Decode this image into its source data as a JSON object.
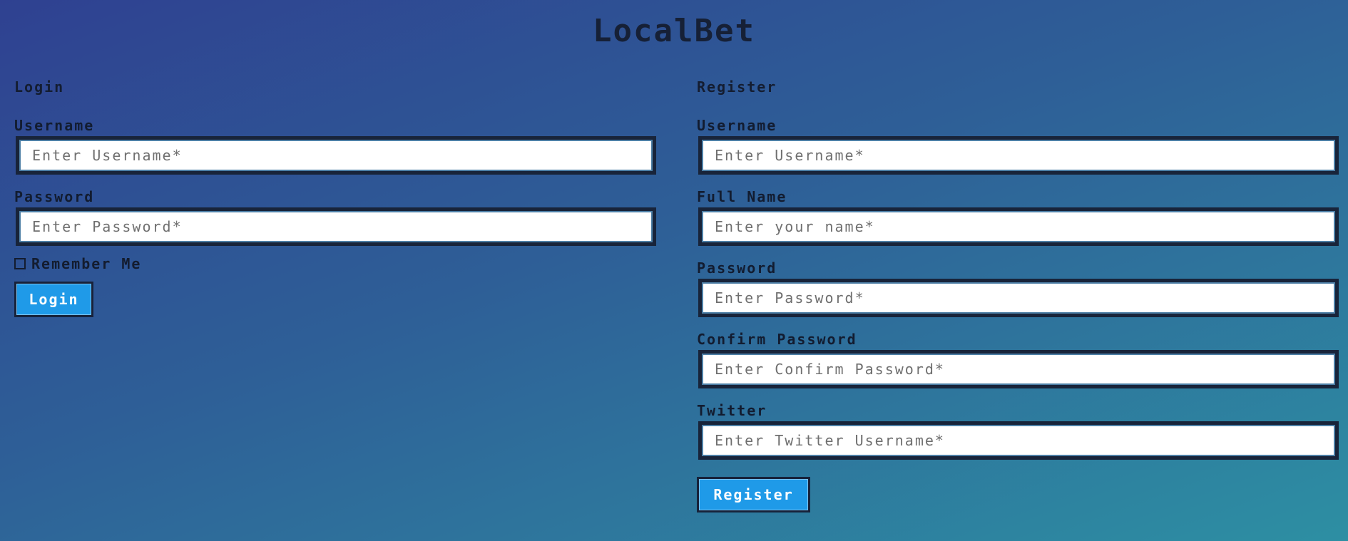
{
  "app": {
    "title": "LocalBet"
  },
  "login": {
    "heading": "Login",
    "username_label": "Username",
    "username_placeholder": "Enter Username*",
    "password_label": "Password",
    "password_placeholder": "Enter Password*",
    "remember_label": "Remember Me",
    "remember_checked": false,
    "button_label": "Login"
  },
  "register": {
    "heading": "Register",
    "username_label": "Username",
    "username_placeholder": "Enter Username*",
    "fullname_label": "Full Name",
    "fullname_placeholder": "Enter your name*",
    "password_label": "Password",
    "password_placeholder": "Enter Password*",
    "confirm_label": "Confirm Password",
    "confirm_placeholder": "Enter Confirm Password*",
    "twitter_label": "Twitter",
    "twitter_placeholder": "Enter Twitter Username*",
    "button_label": "Register"
  },
  "colors": {
    "button": "#1f9ae8",
    "border": "#18243a",
    "gradient_start": "#2f4191",
    "gradient_end": "#2d8fa3"
  }
}
